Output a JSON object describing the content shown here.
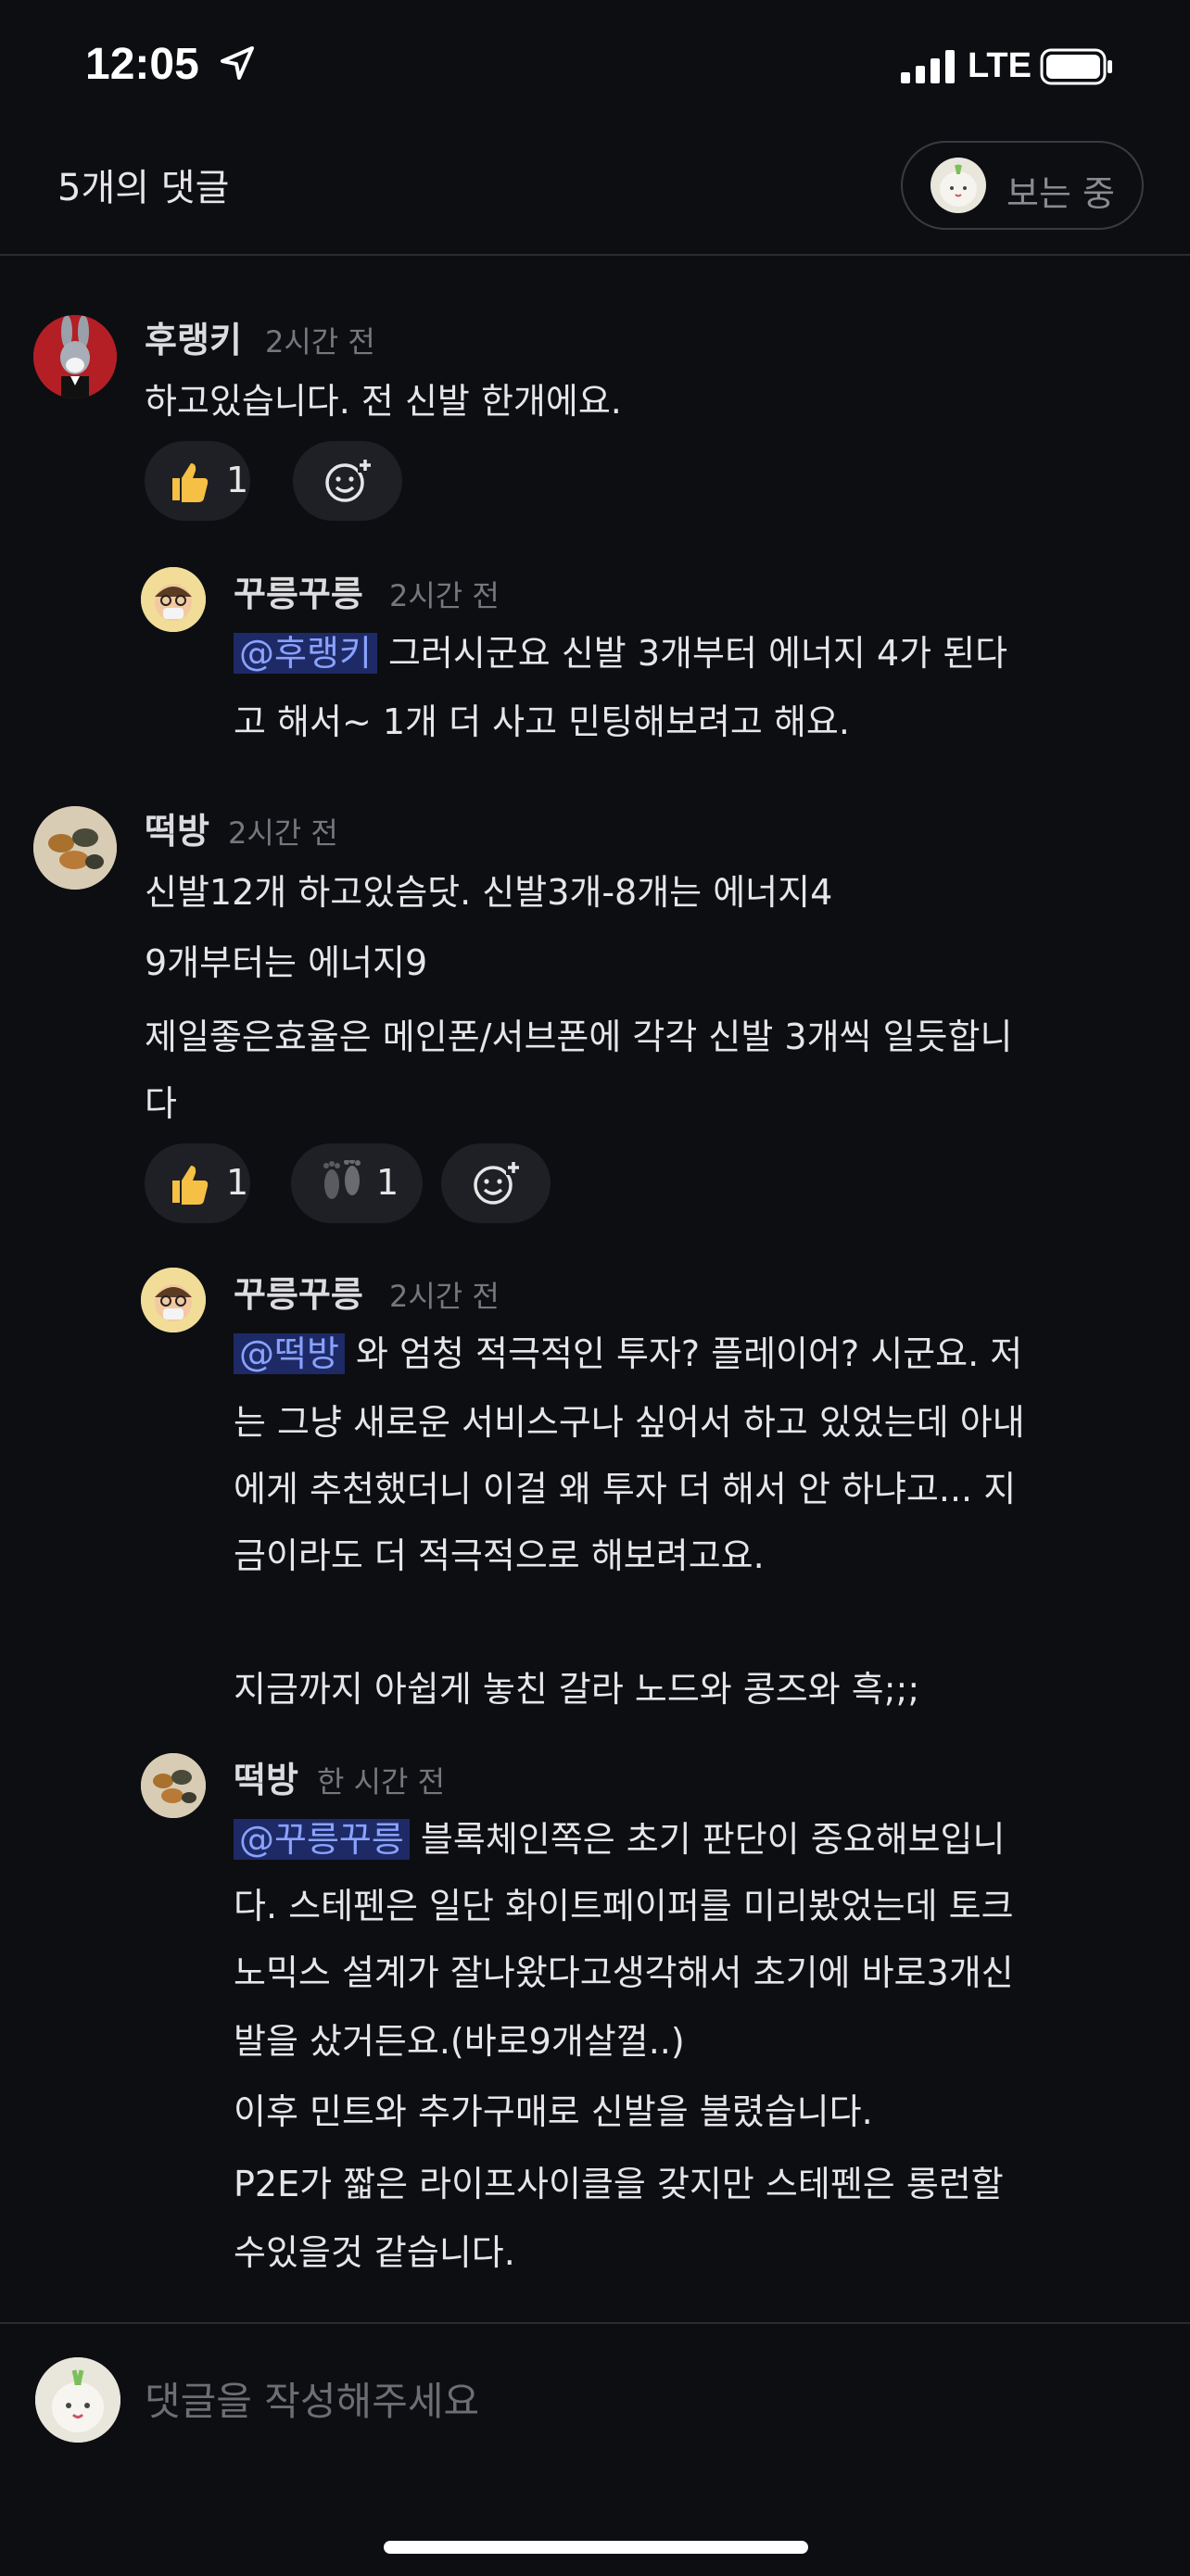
{
  "status": {
    "time": "12:05",
    "network": "LTE"
  },
  "header": {
    "title": "5개의 댓글",
    "viewing_label": "보는 중"
  },
  "comments": [
    {
      "name": "후랭키",
      "time": "2시간 전",
      "lines": [
        "하고있습니다. 전 신발 한개에요."
      ],
      "reactions": [
        {
          "emoji": "thumbs-up",
          "count": "1"
        }
      ]
    },
    {
      "name": "꾸릉꾸릉",
      "time": "2시간 전",
      "mention": "@후랭키",
      "line1_rest": " 그러시군요 신발 3개부터 에너지 4가 된다",
      "lines": [
        "고 해서~ 1개 더 사고 민팅해보려고 해요."
      ]
    },
    {
      "name": "떡방",
      "time": "2시간 전",
      "lines": [
        "신발12개 하고있슴닷. 신발3개-8개는 에너지4",
        "9개부터는 에너지9",
        "제일좋은효율은 메인폰/서브폰에 각각 신발 3개씩 일듯합니",
        "다"
      ],
      "reactions": [
        {
          "emoji": "thumbs-up",
          "count": "1"
        },
        {
          "emoji": "footprints",
          "count": "1"
        }
      ]
    },
    {
      "name": "꾸릉꾸릉",
      "time": "2시간 전",
      "mention": "@떡방",
      "line1_rest": " 와 엄청 적극적인 투자? 플레이어? 시군요. 저",
      "lines": [
        "는 그냥 새로운 서비스구나 싶어서 하고 있었는데 아내",
        "에게 추천했더니 이걸 왜 투자 더 해서 안 하냐고... 지",
        "금이라도 더 적극적으로 해보려고요.",
        "",
        "지금까지 아쉽게 놓친 갈라 노드와 콩즈와 흑;;;"
      ]
    },
    {
      "name": "떡방",
      "time": "한 시간 전",
      "mention": "@꾸릉꾸릉",
      "line1_rest": " 블록체인쪽은 초기 판단이 중요해보입니",
      "lines": [
        "다. 스테펜은 일단 화이트페이퍼를 미리봤었는데 토크",
        "노믹스 설계가 잘나왔다고생각해서 초기에 바로3개신",
        "발을 샀거든요.(바로9개살껄..)",
        "이후 민트와 추가구매로 신발을 불렸습니다.",
        "P2E가 짧은 라이프사이클을 갖지만 스테펜은 롱런할",
        "수있을것 같습니다."
      ]
    }
  ],
  "footer": {
    "placeholder": "댓글을 작성해주세요"
  }
}
